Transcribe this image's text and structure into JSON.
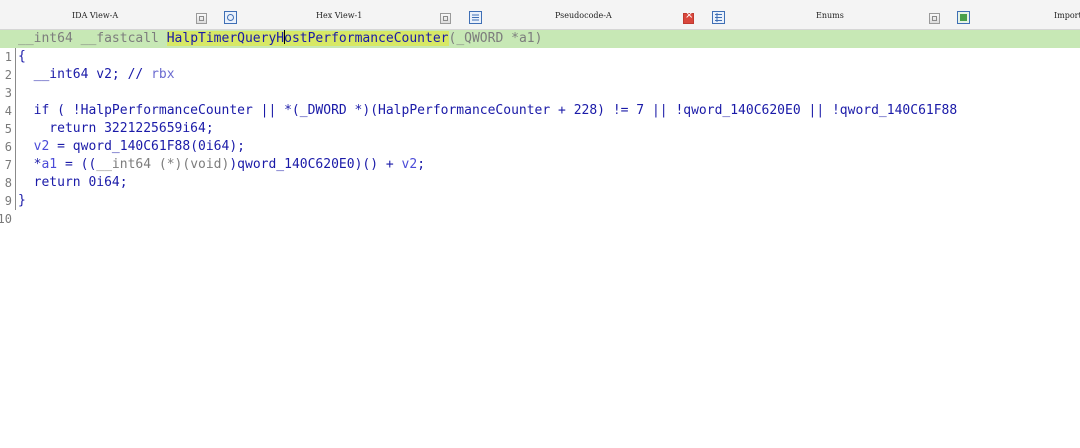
{
  "tabs": [
    {
      "title": "IDA View-A",
      "icon": "disassembly-view-icon",
      "active": false
    },
    {
      "title": "Hex View-1",
      "icon": "hex-view-icon",
      "active": false
    },
    {
      "title": "Pseudocode-A",
      "icon": "pseudocode-icon",
      "active": true
    },
    {
      "title": "Enums",
      "icon": "enums-icon",
      "active": false
    },
    {
      "title": "Import",
      "icon": "imports-icon",
      "active": false
    }
  ],
  "code": {
    "line_numbers": [
      "1",
      "2",
      "3",
      "4",
      "5",
      "6",
      "7",
      "8",
      "9",
      "10"
    ],
    "line1": {
      "ret_type": "__int64 __fastcall ",
      "func_name_a": "HalpTimerQueryH",
      "func_name_b": "ostPerformanceCounter",
      "args": "(_QWORD *a1)"
    },
    "line2": "{",
    "line3": {
      "decl": "  __int64 v2; // ",
      "reg": "rbx"
    },
    "line5": "  if ( !HalpPerformanceCounter || *(_DWORD *)(HalpPerformanceCounter + 228) != 7 || !qword_140C620E0 || !qword_140C61F88",
    "line6": "    return 3221225659i64;",
    "line7": {
      "var": "  v2",
      "rest": " = qword_140C61F88(0i64);"
    },
    "line8": {
      "star": "  *",
      "var": "a1",
      "a": " = ((",
      "cast": "__int64 (*)(void)",
      "b": ")qword_140C620E0)() + ",
      "v2": "v2",
      "end": ";"
    },
    "line9": "  return 0i64;",
    "line10": "}"
  },
  "colors": {
    "highlight_line": "#c7e8b5",
    "highlight_name": "#d7e865",
    "code_text": "#1a1aa8",
    "active_close": "#d9473c"
  }
}
